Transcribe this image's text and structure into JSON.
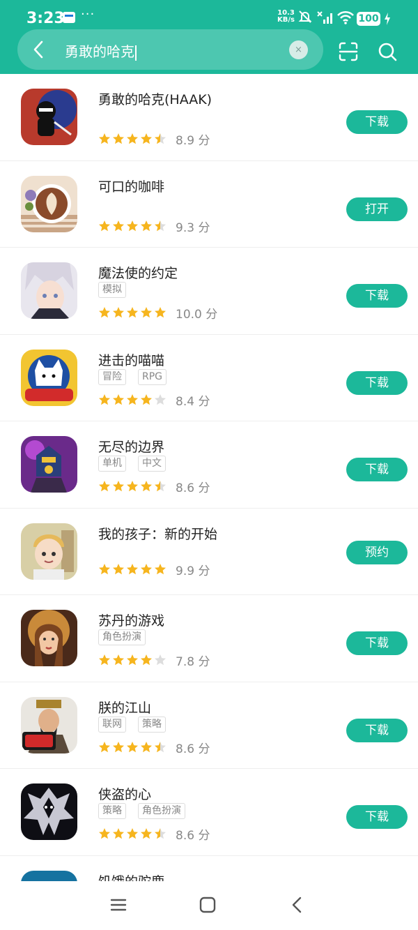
{
  "status": {
    "time": "3:23",
    "speed_value": "10.3",
    "speed_unit": "KB/s",
    "battery": "100"
  },
  "search": {
    "query": "勇敢的哈克",
    "clear_glyph": "×"
  },
  "colors": {
    "accent": "#1cb89a",
    "star": "#f6b51e",
    "star_empty": "#dddddd"
  },
  "apps": [
    {
      "name": "勇敢的哈克(HAAK)",
      "tags": [],
      "rating": 4.5,
      "score": "8.9 分",
      "button": "下载"
    },
    {
      "name": "可口的咖啡",
      "tags": [],
      "rating": 4.5,
      "score": "9.3 分",
      "button": "打开"
    },
    {
      "name": "魔法使的约定",
      "tags": [
        "模拟"
      ],
      "rating": 5,
      "score": "10.0 分",
      "button": "下载"
    },
    {
      "name": "进击的喵喵",
      "tags": [
        "冒险",
        "RPG"
      ],
      "rating": 4,
      "score": "8.4 分",
      "button": "下载"
    },
    {
      "name": "无尽的边界",
      "tags": [
        "单机",
        "中文"
      ],
      "rating": 4.5,
      "score": "8.6 分",
      "button": "下载"
    },
    {
      "name": "我的孩子：新的开始",
      "tags": [],
      "rating": 5,
      "score": "9.9 分",
      "button": "预约"
    },
    {
      "name": "苏丹的游戏",
      "tags": [
        "角色扮演"
      ],
      "rating": 4,
      "score": "7.8 分",
      "button": "下载"
    },
    {
      "name": "朕的江山",
      "tags": [
        "联网",
        "策略"
      ],
      "rating": 4.5,
      "score": "8.6 分",
      "button": "下载"
    },
    {
      "name": "侠盗的心",
      "tags": [
        "策略",
        "角色扮演"
      ],
      "rating": 4.5,
      "score": "8.6 分",
      "button": "下载"
    }
  ],
  "partial_app": {
    "name": "饥饿的驼鹿"
  },
  "icon_names": [
    "menu-icon",
    "home-icon",
    "back-nav-icon"
  ]
}
